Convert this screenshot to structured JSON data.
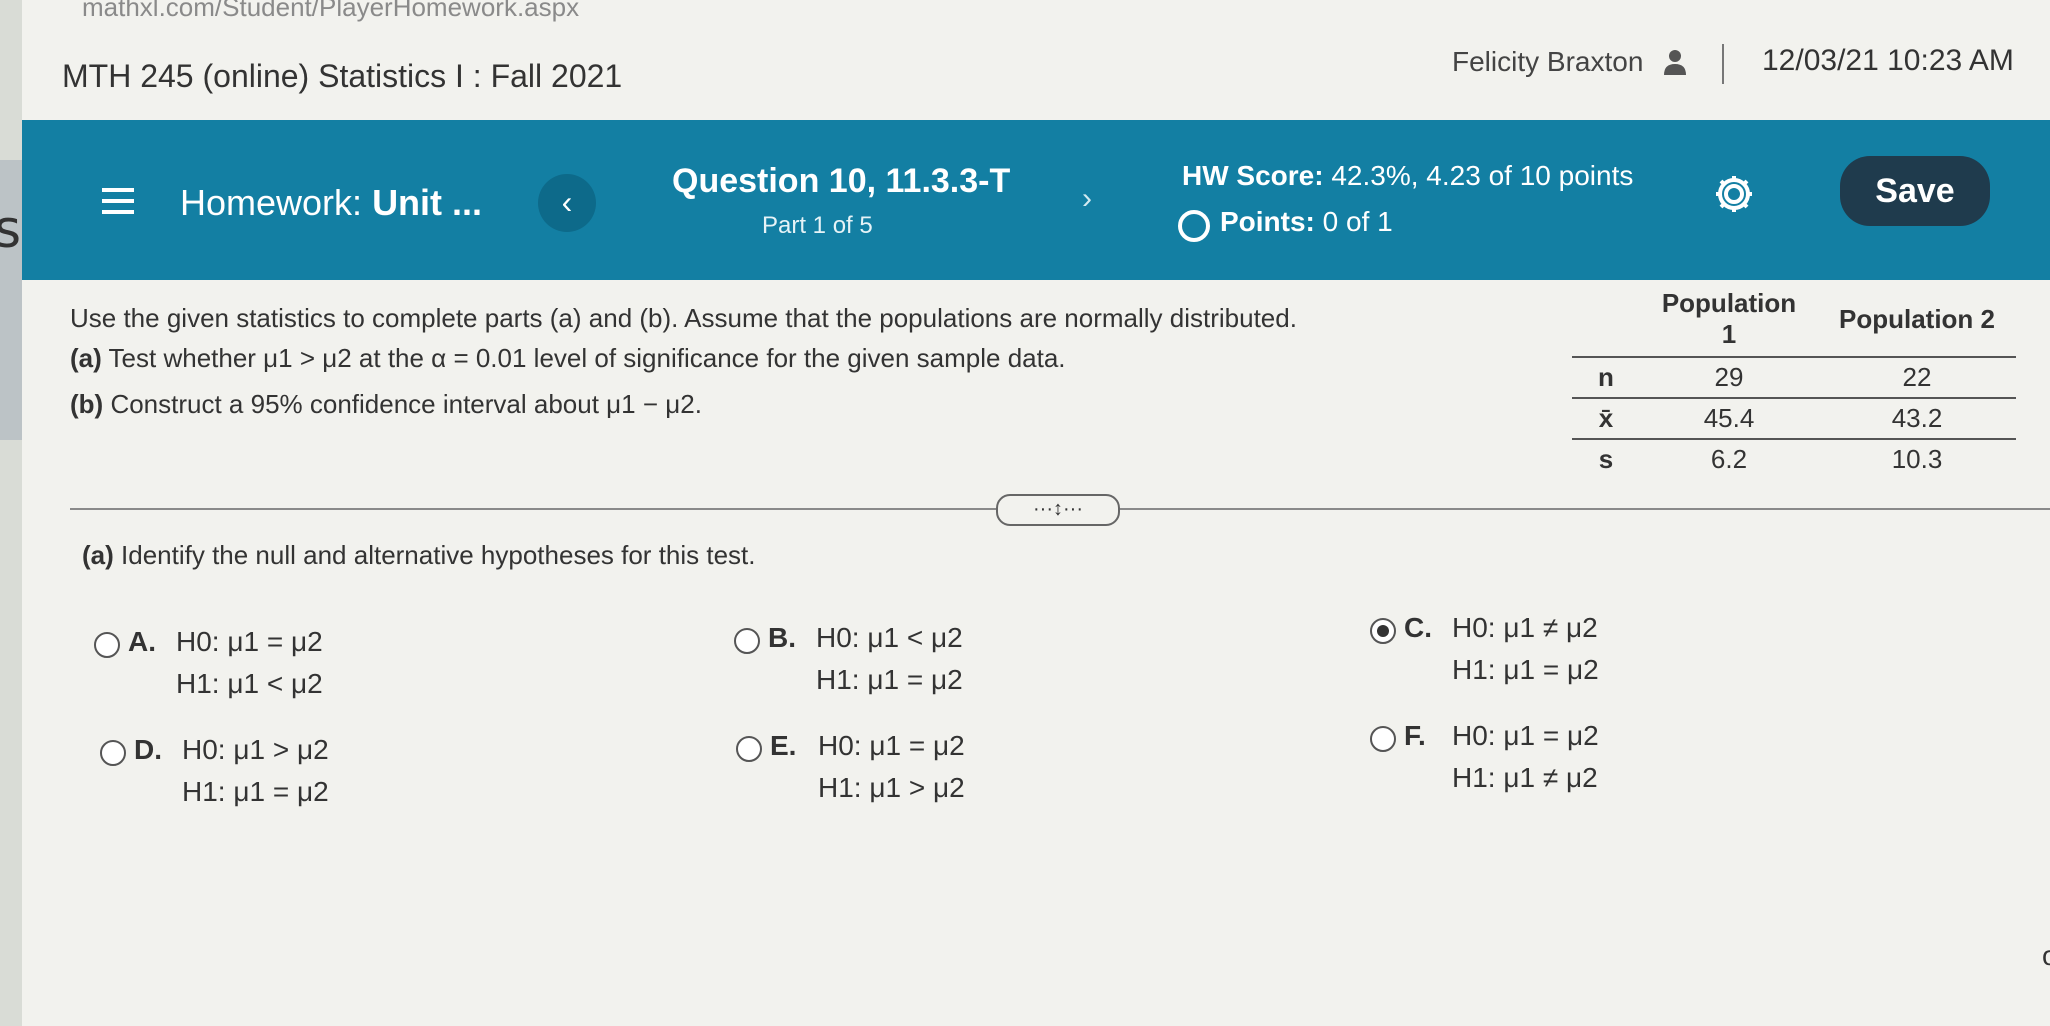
{
  "browser": {
    "url_fragment": "mathxl.com/Student/PlayerHomework.aspx"
  },
  "course": {
    "title": "MTH 245 (online) Statistics I : Fall 2021"
  },
  "user": {
    "name": "Felicity Braxton",
    "separator": "|",
    "datetime": "12/03/21 10:23 AM"
  },
  "left_edge": {
    "text": "st"
  },
  "header": {
    "assignment_prefix": "Homework:",
    "assignment_name": "Unit ...",
    "prev_symbol": "‹",
    "next_symbol": "›",
    "question": "Question 10, 11.3.3-T",
    "part": "Part 1 of 5",
    "hw_score_label": "HW Score:",
    "hw_score_value": "42.3%, 4.23 of 10 points",
    "points_label": "Points:",
    "points_value": "0 of 1",
    "save_label": "Save"
  },
  "problem": {
    "intro": "Use the given statistics to complete parts (a) and (b). Assume that the populations are normally distributed.",
    "part_a_label": "(a)",
    "part_a_text": "Test whether μ1 > μ2 at the α = 0.01 level of significance for the given sample data.",
    "part_b_label": "(b)",
    "part_b_text": "Construct a 95% confidence interval about μ1 − μ2."
  },
  "stats_table": {
    "headers": [
      "",
      "Population 1",
      "Population 2"
    ],
    "rows": [
      {
        "label": "n",
        "pop1": "29",
        "pop2": "22"
      },
      {
        "label": "x̄",
        "pop1": "45.4",
        "pop2": "43.2"
      },
      {
        "label": "s",
        "pop1": "6.2",
        "pop2": "10.3"
      }
    ]
  },
  "divider_handle": {
    "text": "···↕···"
  },
  "question_a": {
    "label": "(a)",
    "text": "Identify the null and alternative hypotheses for this test."
  },
  "options": [
    {
      "letter": "A.",
      "h0": "H0: μ1 = μ2",
      "h1": "H1: μ1 < μ2",
      "selected": false
    },
    {
      "letter": "B.",
      "h0": "H0: μ1 < μ2",
      "h1": "H1: μ1 = μ2",
      "selected": false
    },
    {
      "letter": "C.",
      "h0": "H0: μ1 ≠ μ2",
      "h1": "H1: μ1 = μ2",
      "selected": true
    },
    {
      "letter": "D.",
      "h0": "H0: μ1 > μ2",
      "h1": "H1: μ1 = μ2",
      "selected": false
    },
    {
      "letter": "E.",
      "h0": "H0: μ1 = μ2",
      "h1": "H1: μ1 > μ2",
      "selected": false
    },
    {
      "letter": "F.",
      "h0": "H0: μ1 = μ2",
      "h1": "H1: μ1 ≠ μ2",
      "selected": false
    }
  ],
  "corner": {
    "text": "or"
  },
  "colors": {
    "header_bg": "#137fa3",
    "save_bg": "#1f3b4d",
    "page_bg": "#f2f2ee"
  }
}
